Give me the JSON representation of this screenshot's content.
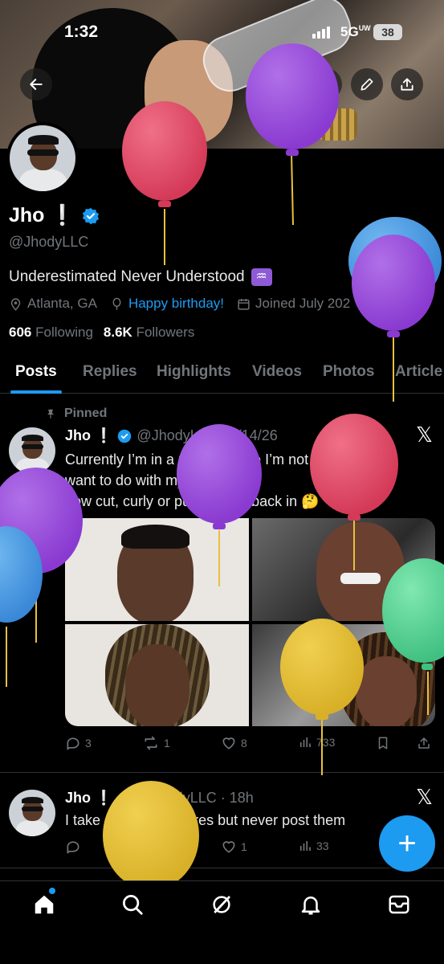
{
  "status_bar": {
    "time": "1:32",
    "network": "5G",
    "network_suffix": "UW",
    "battery": "38"
  },
  "profile": {
    "name": "Jho ❕",
    "handle": "@JhodyLLC",
    "bio": "Underestimated Never Understood",
    "bio_emoji": "♒",
    "location": "Atlanta, GA",
    "birthday_link": "Happy birthday!",
    "joined": "Joined July 202",
    "following_count": "606",
    "following_label": "Following",
    "followers_count": "8.6K",
    "followers_label": "Followers"
  },
  "tabs": [
    "Posts",
    "Replies",
    "Highlights",
    "Videos",
    "Photos",
    "Article"
  ],
  "posts": [
    {
      "pinned_label": "Pinned",
      "name": "Jho ❕",
      "handle_date": "@JhodyLLC · 1/14/26",
      "lines": [
        "Currently I’m in a phase where I’m not sure what I",
        "want to do with my hair.",
        "Low cut, curly or put my locs back in 🤔"
      ],
      "replies": "3",
      "reposts": "1",
      "likes": "8",
      "views": "733"
    },
    {
      "name": "Jho ❕",
      "handle_date": "@JhodyLLC · 18h",
      "text": "I take so many pictures but never post them",
      "likes": "1",
      "views": "33"
    }
  ],
  "icons": {
    "back": "arrow-left-icon",
    "grok": "grok-icon",
    "search": "search-icon",
    "edit": "pencil-icon",
    "share": "share-icon"
  },
  "colors": {
    "accent": "#1d9bf0",
    "muted": "#71767b"
  }
}
